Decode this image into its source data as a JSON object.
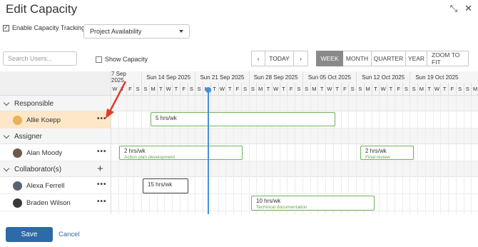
{
  "dialog": {
    "title": "Edit Capacity",
    "enable_label": "Enable Capacity Tracking",
    "enable_checked": true,
    "availability_select": "Project Availability"
  },
  "toolbar": {
    "search_placeholder": "Search Users...",
    "show_capacity_label": "Show Capacity",
    "today_label": "TODAY",
    "prev_glyph": "‹",
    "next_glyph": "›",
    "views": [
      "WEEK",
      "MONTH",
      "QUARTER",
      "YEAR",
      "ZOOM TO FIT"
    ],
    "active_view": "WEEK"
  },
  "timeline": {
    "weeks": [
      "7 Sep 2025",
      "Sun 14 Sep 2025",
      "Sun 21 Sep 2025",
      "Sun 28 Sep 2025",
      "Sun 05 Oct 2025",
      "Sun 12 Oct 2025",
      "Sun 19 Oct 2025"
    ],
    "day_letters": [
      "W",
      "T",
      "F",
      "S",
      "S",
      "M",
      "T",
      "W",
      "T",
      "F",
      "S",
      "S",
      "M",
      "T",
      "W",
      "T",
      "F",
      "S",
      "S",
      "M",
      "T",
      "W",
      "T",
      "F",
      "S",
      "S",
      "M",
      "T",
      "W",
      "T",
      "F",
      "S",
      "S",
      "M",
      "T",
      "W",
      "T",
      "F",
      "S",
      "S",
      "M",
      "T",
      "W",
      "T",
      "F",
      "S",
      "S",
      "M"
    ]
  },
  "groups": [
    {
      "label": "Responsible",
      "people": [
        {
          "name": "Allie Koepp",
          "highlighted": true
        }
      ]
    },
    {
      "label": "Assigner",
      "people": [
        {
          "name": "Alan Moody",
          "highlighted": false
        }
      ]
    },
    {
      "label": "Collaborator(s)",
      "people": [
        {
          "name": "Alexa Ferrell",
          "highlighted": false
        },
        {
          "name": "Braden Wilson",
          "highlighted": false
        }
      ]
    }
  ],
  "bars": [
    {
      "hrs": "5 hrs/wk",
      "task": ""
    },
    {
      "hrs": "2 hrs/wk",
      "task": "Action plan development"
    },
    {
      "hrs": "2 hrs/wk",
      "task": "Final review"
    },
    {
      "hrs": "15 hrs/wk",
      "task": ""
    },
    {
      "hrs": "10 hrs/wk",
      "task": "Technical documentation"
    }
  ],
  "footer": {
    "save_label": "Save",
    "cancel_label": "Cancel"
  },
  "colors": {
    "accent": "#2d6aa8",
    "today_line": "#4a8fd4",
    "bar_border": "#6db35a",
    "highlight": "#fde7c8",
    "annotation_arrow": "#e03a2a"
  }
}
